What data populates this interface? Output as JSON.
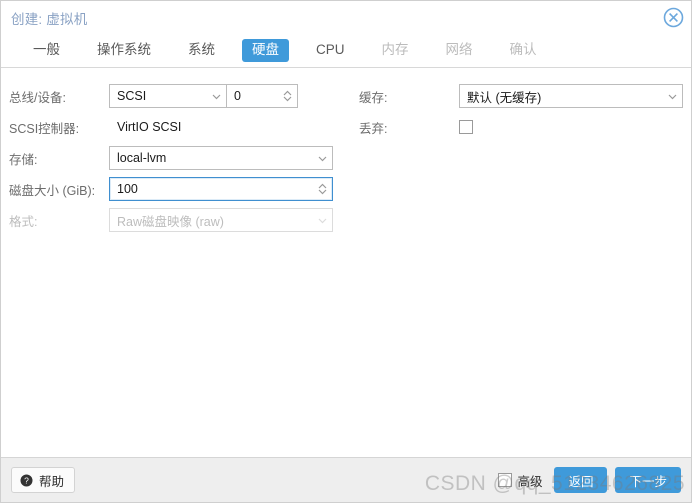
{
  "window": {
    "title": "创建: 虚拟机",
    "close_icon": "close-circle-icon"
  },
  "tabs": [
    {
      "label": "一般",
      "state": "enabled"
    },
    {
      "label": "操作系统",
      "state": "enabled"
    },
    {
      "label": "系统",
      "state": "enabled"
    },
    {
      "label": "硬盘",
      "state": "active"
    },
    {
      "label": "CPU",
      "state": "enabled"
    },
    {
      "label": "内存",
      "state": "disabled"
    },
    {
      "label": "网络",
      "state": "disabled"
    },
    {
      "label": "确认",
      "state": "disabled"
    }
  ],
  "form": {
    "left": {
      "bus_device": {
        "label": "总线/设备:",
        "bus_value": "SCSI",
        "index_value": "0"
      },
      "scsi_controller": {
        "label": "SCSI控制器:",
        "value": "VirtIO SCSI"
      },
      "storage": {
        "label": "存储:",
        "value": "local-lvm"
      },
      "disk_size": {
        "label": "磁盘大小 (GiB):",
        "value": "100"
      },
      "format": {
        "label": "格式:",
        "value": "Raw磁盘映像 (raw)"
      }
    },
    "right": {
      "cache": {
        "label": "缓存:",
        "value": "默认 (无缓存)"
      },
      "discard": {
        "label": "丢弃:",
        "checked": false
      }
    }
  },
  "footer": {
    "help_label": "帮助",
    "help_icon": "question-circle-icon",
    "advanced_label": "高级",
    "advanced_checked": false,
    "back_label": "返回",
    "next_label": "下一步"
  },
  "watermark": {
    "text": "CSDN @qq_51234626825"
  },
  "colors": {
    "accent_blue": "#3f9ada",
    "title_text": "#8aa2c4",
    "footer_bg": "#eeeeee",
    "label_text": "#6d6d6d",
    "disabled_text": "#bdbdbd"
  }
}
